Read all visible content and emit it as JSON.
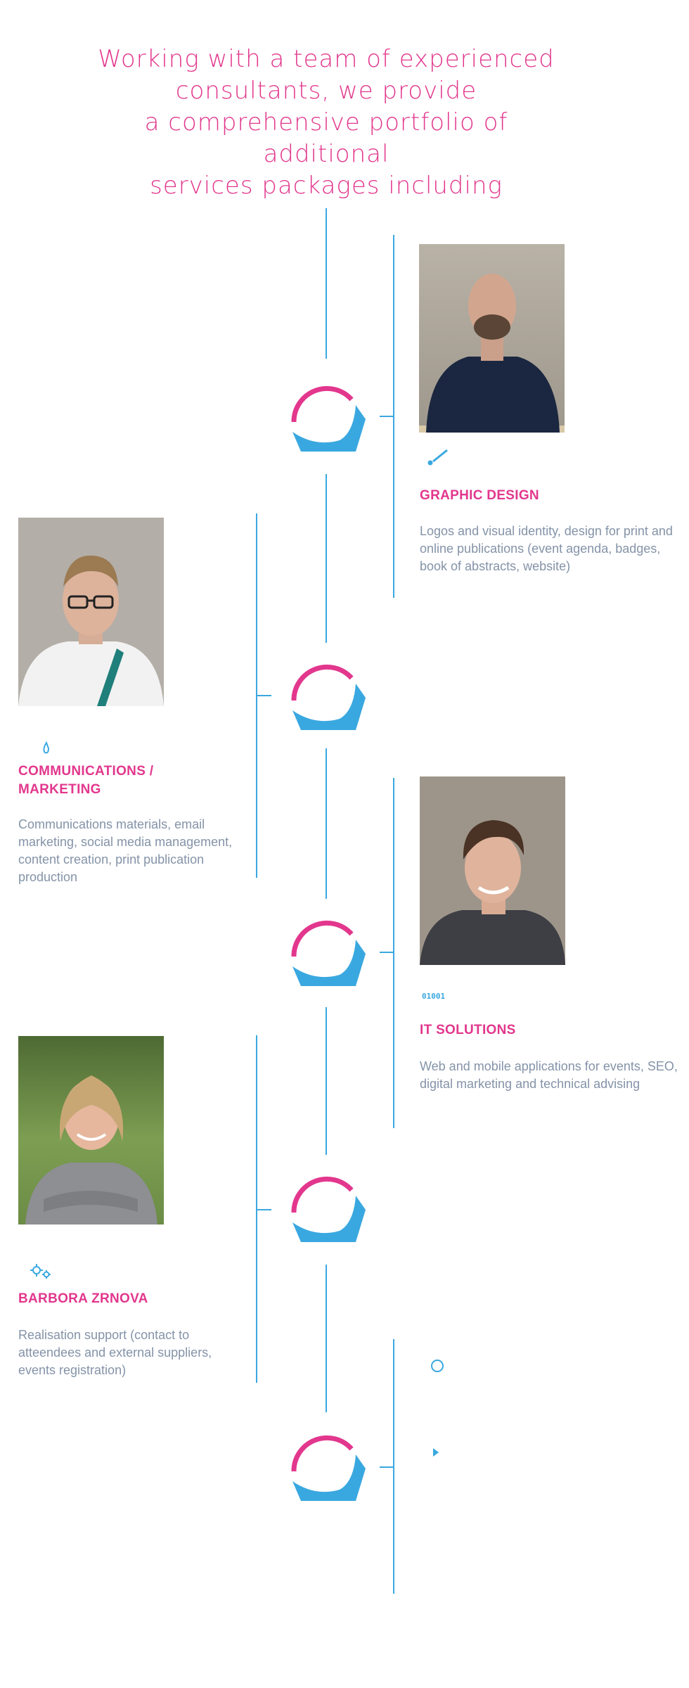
{
  "intro": {
    "lines": [
      "Working with a team of experienced",
      "consultants, we provide",
      "a comprehensive portfolio of additional",
      "services packages including"
    ]
  },
  "colors": {
    "accent_pink": "#e2378d",
    "accent_blue": "#3aa8e0",
    "body_text": "#8493a8"
  },
  "services": [
    {
      "icon": "pen-icon",
      "title": "GRAPHIC DESIGN",
      "text": "Logos and visual identity, design for print and online publications (event agenda, badges, book of abstracts, website)"
    },
    {
      "icon": "droplet-icon",
      "title": "COMMUNICATIONS / MARKETING",
      "text": "Communications materials, email marketing, social media management, content creation, print publication production"
    },
    {
      "icon": "binary-icon",
      "title": "IT SOLUTIONS",
      "icon_text": "01001",
      "text": "Web and mobile applications for events, SEO, digital marketing and technical advising"
    },
    {
      "icon": "gears-icon",
      "title": "BARBORA ZRNOVA",
      "text": "Realisation support (contact to atteendees and external suppliers, events registration)"
    }
  ]
}
